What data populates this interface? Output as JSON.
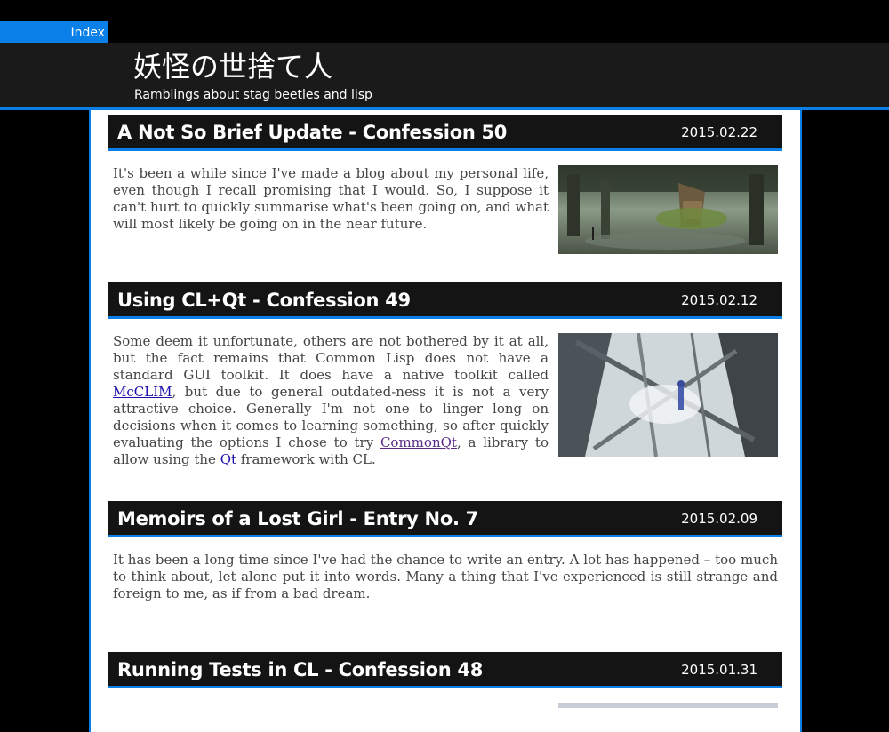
{
  "nav": {
    "index_label": "Index"
  },
  "site": {
    "title": "妖怪の世捨て人",
    "subtitle": "Ramblings about stag beetles and lisp"
  },
  "posts": [
    {
      "title": "A Not So Brief Update - Confession 50",
      "date": "2015.02.22",
      "text": "It's been a while since I've made a blog about my personal life, even though I recall promising that I would. So, I suppose it can't hurt to quickly summarise what's been going on, and what will most likely be going on in the near future.",
      "image": "forest-treehouse-illustration"
    },
    {
      "title": "Using CL+Qt - Confession 49",
      "date": "2015.02.12",
      "text_1": "Some deem it unfortunate, others are not bothered by it at all, but the fact remains that Common Lisp does not have a standard GUI toolkit. It does have a native toolkit called ",
      "link_mcclim": "McCLIM",
      "text_2": ", but due to general outdated-ness it is not a very attractive choice. Generally I'm not one to linger long on decisions when it comes to learning something, so after quickly evaluating the options I chose to try ",
      "link_commonqt": "CommonQt",
      "text_3": ", a library to allow using the ",
      "link_qt": "Qt",
      "text_4": " framework with CL.",
      "image": "ruined-structure-girl-illustration"
    },
    {
      "title": "Memoirs of a Lost Girl - Entry No. 7",
      "date": "2015.02.09",
      "text": "It has been a long time since I've had the chance to write an entry. A lot has happened – too much to think about, let alone put it into words. Many a thing that I've experienced is still strange and foreign to me, as if from a bad dream."
    },
    {
      "title": "Running Tests in CL - Confession 48",
      "date": "2015.01.31"
    }
  ]
}
